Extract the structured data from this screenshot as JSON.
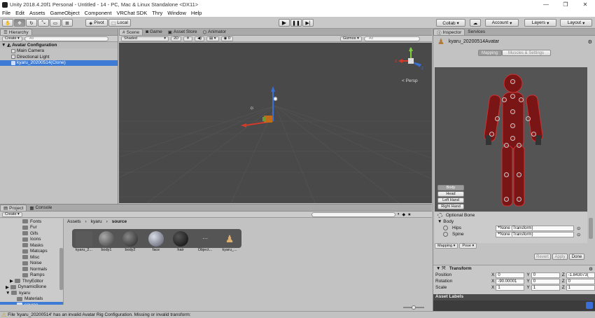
{
  "window": {
    "title": "Unity 2018.4.20f1 Personal - Untitled - 14 - PC, Mac & Linux Standalone <DX11>",
    "controls": [
      "—",
      "❐",
      "✕"
    ]
  },
  "menu": [
    "File",
    "Edit",
    "Assets",
    "GameObject",
    "Component",
    "VRChat SDK",
    "Thry",
    "Window",
    "Help"
  ],
  "toolbar": {
    "pivot": "Pivot",
    "local": "Local",
    "collab": "Collab ▾",
    "account": "Account",
    "layers": "Layers",
    "layout": "Layout"
  },
  "hierarchy": {
    "tab": "Hierarchy",
    "create": "Create",
    "search_placeholder": "All",
    "scene": "Avatar Configuration",
    "items": [
      "Main Camera",
      "Directional Light",
      "kyaru_20200514(Clone)"
    ]
  },
  "scene_view": {
    "tabs": [
      "Scene",
      "Game",
      "Asset Store",
      "Animator"
    ],
    "shading": "Shaded",
    "mode_2d": "2D",
    "gizmos": "Gizmos ▾",
    "search_placeholder": "All",
    "persp": "< Persp",
    "axis_labels": {
      "y": "y",
      "x": "x",
      "z": "z"
    }
  },
  "project": {
    "tabs": [
      "Project",
      "Console"
    ],
    "create": "Create",
    "breadcrumb": [
      "Assets",
      "kyaru",
      "source"
    ],
    "folders": [
      {
        "label": "Fonts",
        "indent": 1
      },
      {
        "label": "Fur",
        "indent": 1
      },
      {
        "label": "Gifs",
        "indent": 1
      },
      {
        "label": "Icons",
        "indent": 1
      },
      {
        "label": "Masks",
        "indent": 1
      },
      {
        "label": "Matcaps",
        "indent": 1
      },
      {
        "label": "Misc",
        "indent": 1
      },
      {
        "label": "Noise",
        "indent": 1
      },
      {
        "label": "Normals",
        "indent": 1
      },
      {
        "label": "Ramps",
        "indent": 1
      },
      {
        "label": "ThryEditor",
        "indent": 0
      },
      {
        "label": "DynamicBone",
        "indent": 0
      },
      {
        "label": "kyaru",
        "indent": 0
      },
      {
        "label": "Materials",
        "indent": 1
      },
      {
        "label": "source",
        "indent": 1
      }
    ],
    "assets": [
      "kyaru_2...",
      "body1",
      "body2",
      "face",
      "hair",
      "Object...",
      "kyaru_..."
    ]
  },
  "inspector": {
    "tabs": [
      "Inspector",
      "Services"
    ],
    "avatar_name": "kyaru_20200514Avatar",
    "mode_tabs": [
      "Mapping",
      "Muscles & Settings"
    ],
    "body_buttons": [
      "Body",
      "Head",
      "Left Hand",
      "Right Hand"
    ],
    "optional_bone": "Optional Bone",
    "body_label": "Body",
    "bones": [
      {
        "name": "Hips",
        "value": "None (Transform)"
      },
      {
        "name": "Spine",
        "value": "None (Transform)"
      }
    ],
    "mapping_drop": "Mapping ▾",
    "pose_drop": "Pose ▾",
    "revert": "Revert",
    "apply": "Apply",
    "done": "Done",
    "transform": {
      "title": "Transform",
      "rows": [
        {
          "label": "Position",
          "x": "0",
          "y": "0",
          "z": "-1.843073("
        },
        {
          "label": "Rotation",
          "x": "-90.00001",
          "y": "0",
          "z": "0"
        },
        {
          "label": "Scale",
          "x": "1",
          "y": "1",
          "z": "1"
        }
      ],
      "axis": [
        "X",
        "Y",
        "Z"
      ]
    },
    "asset_labels": "Asset Labels"
  },
  "status": {
    "message": "File 'kyaru_20200514' has an invalid Avatar Rig Configuration. Missing or invalid transform:"
  },
  "colors": {
    "selection": "#3d7bd5",
    "scene_bg": "#494949",
    "avatar_red": "#8a1a1a",
    "axis_x": "#d23a2a",
    "axis_y": "#7fcf3a",
    "axis_z": "#3a6fd8"
  }
}
